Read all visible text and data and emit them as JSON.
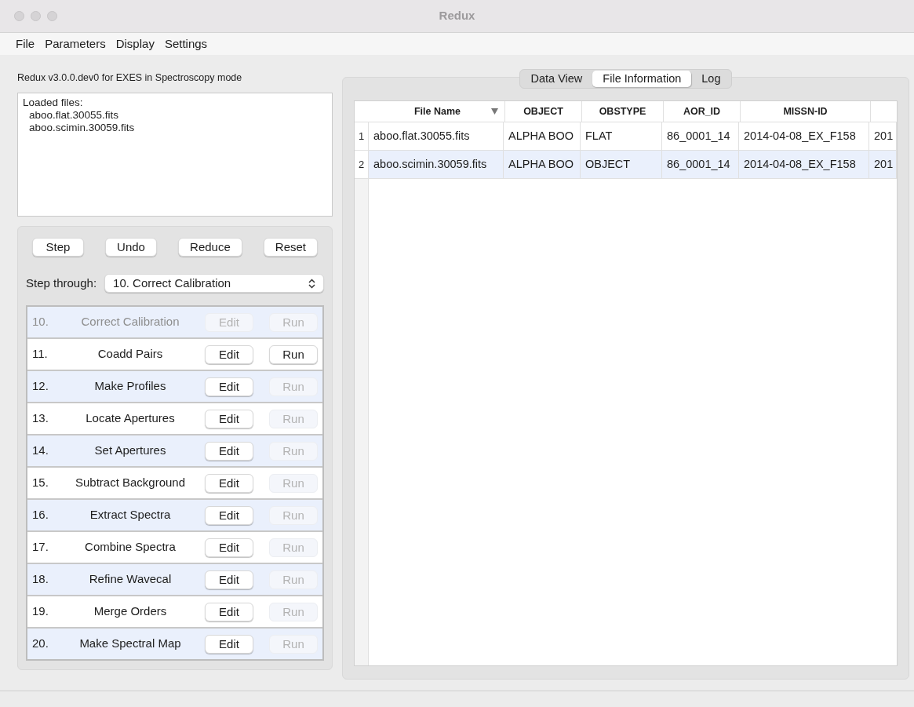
{
  "window": {
    "title": "Redux"
  },
  "menu": [
    "File",
    "Parameters",
    "Display",
    "Settings"
  ],
  "info": "Redux v3.0.0.dev0 for EXES in Spectroscopy mode",
  "loaded_files": {
    "heading": "Loaded files:",
    "files": [
      "aboo.flat.30055.fits",
      "aboo.scimin.30059.fits"
    ]
  },
  "actions": [
    "Step",
    "Undo",
    "Reduce",
    "Reset"
  ],
  "step_through": {
    "label": "Step through:",
    "value": "10. Correct Calibration"
  },
  "steps": [
    {
      "number": "10.",
      "name": "Correct Calibration",
      "disabled": true,
      "edit": {
        "label": "Edit",
        "enabled": false
      },
      "run": {
        "label": "Run",
        "enabled": false
      }
    },
    {
      "number": "11.",
      "name": "Coadd Pairs",
      "disabled": false,
      "edit": {
        "label": "Edit",
        "enabled": true
      },
      "run": {
        "label": "Run",
        "enabled": true
      }
    },
    {
      "number": "12.",
      "name": "Make Profiles",
      "disabled": false,
      "edit": {
        "label": "Edit",
        "enabled": true
      },
      "run": {
        "label": "Run",
        "enabled": false
      }
    },
    {
      "number": "13.",
      "name": "Locate Apertures",
      "disabled": false,
      "edit": {
        "label": "Edit",
        "enabled": true
      },
      "run": {
        "label": "Run",
        "enabled": false
      }
    },
    {
      "number": "14.",
      "name": "Set Apertures",
      "disabled": false,
      "edit": {
        "label": "Edit",
        "enabled": true
      },
      "run": {
        "label": "Run",
        "enabled": false
      }
    },
    {
      "number": "15.",
      "name": "Subtract Background",
      "disabled": false,
      "edit": {
        "label": "Edit",
        "enabled": true
      },
      "run": {
        "label": "Run",
        "enabled": false
      }
    },
    {
      "number": "16.",
      "name": "Extract Spectra",
      "disabled": false,
      "edit": {
        "label": "Edit",
        "enabled": true
      },
      "run": {
        "label": "Run",
        "enabled": false
      }
    },
    {
      "number": "17.",
      "name": "Combine Spectra",
      "disabled": false,
      "edit": {
        "label": "Edit",
        "enabled": true
      },
      "run": {
        "label": "Run",
        "enabled": false
      }
    },
    {
      "number": "18.",
      "name": "Refine Wavecal",
      "disabled": false,
      "edit": {
        "label": "Edit",
        "enabled": true
      },
      "run": {
        "label": "Run",
        "enabled": false
      }
    },
    {
      "number": "19.",
      "name": "Merge Orders",
      "disabled": false,
      "edit": {
        "label": "Edit",
        "enabled": true
      },
      "run": {
        "label": "Run",
        "enabled": false
      }
    },
    {
      "number": "20.",
      "name": "Make Spectral Map",
      "disabled": false,
      "edit": {
        "label": "Edit",
        "enabled": true
      },
      "run": {
        "label": "Run",
        "enabled": false
      }
    }
  ],
  "tabs": [
    {
      "label": "Data View",
      "selected": false
    },
    {
      "label": "File Information",
      "selected": true
    },
    {
      "label": "Log",
      "selected": false
    }
  ],
  "table": {
    "columns": [
      "File Name",
      "OBJECT",
      "OBSTYPE",
      "AOR_ID",
      "MISSN-ID"
    ],
    "rows": [
      {
        "index": "1",
        "cells": [
          "aboo.flat.30055.fits",
          "ALPHA BOO",
          "FLAT",
          "86_0001_14",
          "2014-04-08_EX_F158",
          "201"
        ]
      },
      {
        "index": "2",
        "cells": [
          "aboo.scimin.30059.fits",
          "ALPHA BOO",
          "OBJECT",
          "86_0001_14",
          "2014-04-08_EX_F158",
          "201"
        ]
      }
    ]
  }
}
